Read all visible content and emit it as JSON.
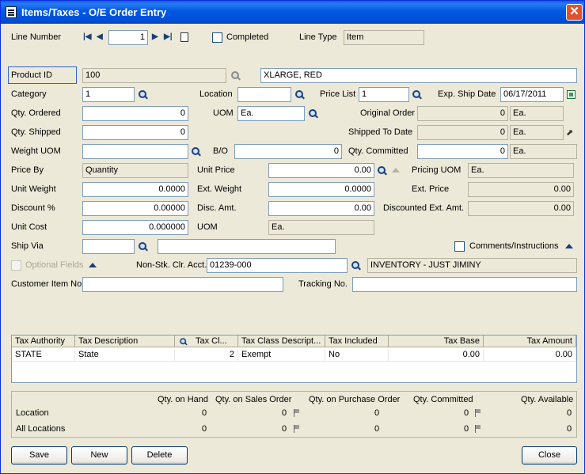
{
  "window": {
    "title": "Items/Taxes - O/E Order Entry",
    "close_glyph": "✕"
  },
  "header": {
    "line_number_label": "Line Number",
    "line_number_value": "1",
    "completed_label": "Completed",
    "line_type_label": "Line Type",
    "line_type_value": "Item"
  },
  "product": {
    "product_id_label": "Product ID",
    "product_id_value": "100",
    "description": "XLARGE, RED"
  },
  "fields": {
    "category_label": "Category",
    "category_value": "1",
    "location_label": "Location",
    "location_value": "",
    "price_list_label": "Price List",
    "price_list_value": "1",
    "exp_ship_date_label": "Exp. Ship Date",
    "exp_ship_date_value": "06/17/2011",
    "qty_ordered_label": "Qty. Ordered",
    "qty_ordered_value": "0",
    "uom_label": "UOM",
    "uom_value": "Ea.",
    "original_order_label": "Original Order",
    "original_order_value": "0",
    "original_order_uom": "Ea.",
    "qty_shipped_label": "Qty. Shipped",
    "qty_shipped_value": "0",
    "shipped_to_date_label": "Shipped To Date",
    "shipped_to_date_value": "0",
    "shipped_to_date_uom": "Ea.",
    "weight_uom_label": "Weight UOM",
    "weight_uom_value": "",
    "bo_label": "B/O",
    "bo_value": "0",
    "qty_committed_label": "Qty. Committed",
    "qty_committed_value": "0",
    "qty_committed_uom": "Ea.",
    "price_by_label": "Price By",
    "price_by_value": "Quantity",
    "unit_price_label": "Unit Price",
    "unit_price_value": "0.00",
    "pricing_uom_label": "Pricing UOM",
    "pricing_uom_value": "Ea.",
    "unit_weight_label": "Unit Weight",
    "unit_weight_value": "0.0000",
    "ext_weight_label": "Ext. Weight",
    "ext_weight_value": "0.0000",
    "ext_price_label": "Ext. Price",
    "ext_price_value": "0.00",
    "discount_pct_label": "Discount %",
    "discount_pct_value": "0.00000",
    "disc_amt_label": "Disc. Amt.",
    "disc_amt_value": "0.00",
    "discounted_ext_amt_label": "Discounted Ext. Amt.",
    "discounted_ext_amt_value": "0.00",
    "unit_cost_label": "Unit Cost",
    "unit_cost_value": "0.000000",
    "uom2_label": "UOM",
    "uom2_value": "Ea.",
    "ship_via_label": "Ship Via",
    "ship_via_value": "",
    "ship_via_desc": "",
    "comments_label": "Comments/Instructions",
    "optional_fields_label": "Optional Fields",
    "non_stk_label": "Non-Stk. Clr. Acct.",
    "non_stk_value": "01239-000",
    "non_stk_desc": "INVENTORY - JUST JIMINY",
    "customer_item_label": "Customer Item No.",
    "customer_item_value": "",
    "tracking_label": "Tracking No.",
    "tracking_value": ""
  },
  "tax_grid": {
    "headers": [
      "Tax Authority",
      "Tax Description",
      "Tax Cl...",
      "Tax Class Descript...",
      "Tax Included",
      "Tax Base",
      "Tax Amount"
    ],
    "rows": [
      [
        "STATE",
        "State",
        "2",
        "Exempt",
        "No",
        "0.00",
        "0.00"
      ]
    ]
  },
  "inventory": {
    "headers": [
      "Qty. on Hand",
      "Qty. on Sales Order",
      "Qty. on Purchase Order",
      "Qty. Committed",
      "Qty. Available"
    ],
    "rows": [
      {
        "label": "Location",
        "values": [
          "0",
          "0",
          "0",
          "0",
          "0"
        ]
      },
      {
        "label": "All Locations",
        "values": [
          "0",
          "0",
          "0",
          "0",
          "0"
        ]
      }
    ]
  },
  "buttons": {
    "save": "Save",
    "new": "New",
    "delete": "Delete",
    "close": "Close"
  },
  "colors": {
    "title_bar": "#0058e3",
    "window_bg": "#ece9d8",
    "input_border": "#7f9db9"
  }
}
